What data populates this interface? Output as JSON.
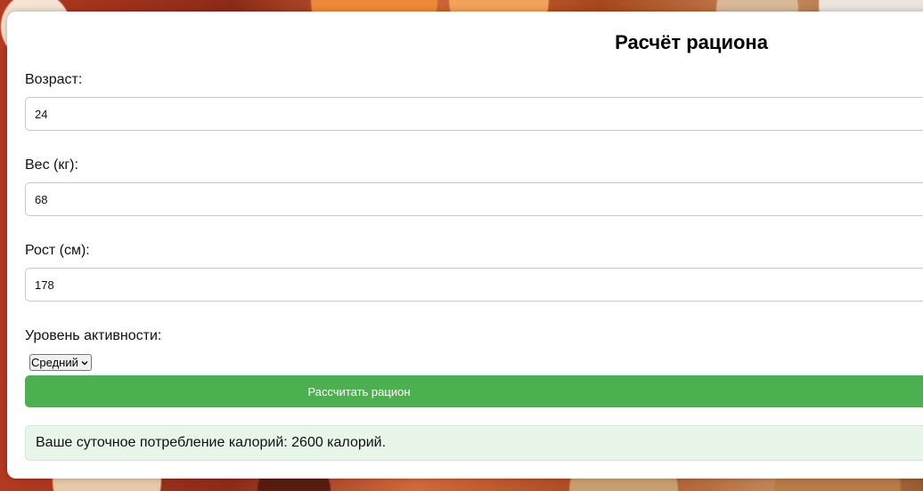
{
  "form": {
    "title": "Расчёт рациона",
    "age": {
      "label": "Возраст:",
      "value": "24"
    },
    "weight": {
      "label": "Вес (кг):",
      "value": "68"
    },
    "height": {
      "label": "Рост (см):",
      "value": "178"
    },
    "activity": {
      "label": "Уровень активности:",
      "selected": "Средний"
    },
    "submit_label": "Рассчитать рацион",
    "result_text": "Ваше суточное потребление калорий: 2600 калорий."
  },
  "colors": {
    "button": "#4caf50",
    "result_bg": "#e8f5e9"
  },
  "icons": {
    "select_arrow": "chevron-down-icon"
  }
}
